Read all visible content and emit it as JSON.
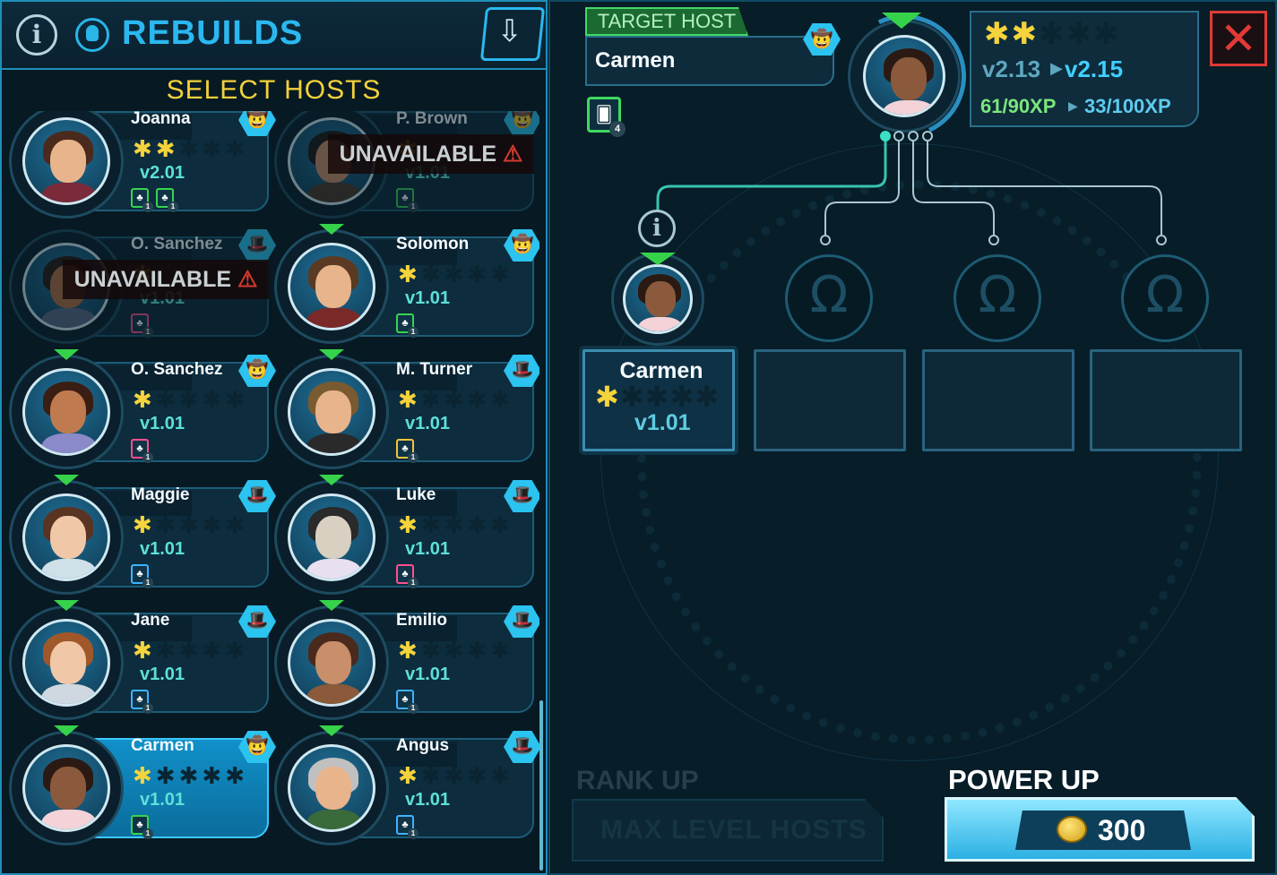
{
  "header": {
    "info_icon": "info-icon",
    "rebuild_icon": "rebuild-icon",
    "title": "REBUILDS",
    "sort_icon": "sort-icon"
  },
  "subtitle": "SELECT HOSTS",
  "unavailable_label": "UNAVAILABLE",
  "hosts": [
    {
      "name": "Joanna",
      "stars_on": 2,
      "stars_total": 5,
      "version": "v2.01",
      "hat": "white-hat",
      "badges": [
        "1",
        "1"
      ],
      "available": true,
      "selected": false
    },
    {
      "name": "P. Brown",
      "stars_on": 1,
      "stars_total": 5,
      "version": "v1.01",
      "hat": "white-hat",
      "badges": [
        "1"
      ],
      "available": false,
      "selected": false
    },
    {
      "name": "O. Sanchez",
      "stars_on": 1,
      "stars_total": 5,
      "version": "v1.01",
      "hat": "black-hat",
      "badges": [
        "1"
      ],
      "available": false,
      "selected": false
    },
    {
      "name": "Solomon",
      "stars_on": 1,
      "stars_total": 5,
      "version": "v1.01",
      "hat": "white-hat",
      "badges": [
        "1"
      ],
      "available": true,
      "selected": false
    },
    {
      "name": "O. Sanchez",
      "stars_on": 1,
      "stars_total": 5,
      "version": "v1.01",
      "hat": "white-hat",
      "badges": [
        "1"
      ],
      "available": true,
      "selected": false
    },
    {
      "name": "M. Turner",
      "stars_on": 1,
      "stars_total": 5,
      "version": "v1.01",
      "hat": "black-hat",
      "badges": [
        "1"
      ],
      "available": true,
      "selected": false
    },
    {
      "name": "Maggie",
      "stars_on": 1,
      "stars_total": 5,
      "version": "v1.01",
      "hat": "black-hat",
      "badges": [
        "1"
      ],
      "available": true,
      "selected": false
    },
    {
      "name": "Luke",
      "stars_on": 1,
      "stars_total": 5,
      "version": "v1.01",
      "hat": "black-hat",
      "badges": [
        "1"
      ],
      "available": true,
      "selected": false
    },
    {
      "name": "Jane",
      "stars_on": 1,
      "stars_total": 5,
      "version": "v1.01",
      "hat": "black-hat",
      "badges": [
        "1"
      ],
      "available": true,
      "selected": false
    },
    {
      "name": "Emilio",
      "stars_on": 1,
      "stars_total": 5,
      "version": "v1.01",
      "hat": "black-hat",
      "badges": [
        "1"
      ],
      "available": true,
      "selected": false
    },
    {
      "name": "Carmen",
      "stars_on": 1,
      "stars_total": 5,
      "version": "v1.01",
      "hat": "brown-hat",
      "badges": [
        "1"
      ],
      "available": true,
      "selected": true
    },
    {
      "name": "Angus",
      "stars_on": 1,
      "stars_total": 5,
      "version": "v1.01",
      "hat": "black-hat",
      "badges": [
        "1"
      ],
      "available": true,
      "selected": false
    }
  ],
  "target": {
    "label": "TARGET HOST",
    "name": "Carmen",
    "hat": "brown-hat",
    "card_count": "4",
    "stars_on": 2,
    "stars_total": 5,
    "version_from": "v2.13",
    "version_to": "v2.15",
    "xp_from": "61/90XP",
    "xp_to": "33/100XP"
  },
  "slots": [
    {
      "name": "Carmen",
      "stars_on": 1,
      "stars_total": 5,
      "version": "v1.01",
      "filled": true
    },
    {
      "filled": false
    },
    {
      "filled": false
    },
    {
      "filled": false
    }
  ],
  "rank_up": {
    "label": "RANK UP",
    "button": "MAX LEVEL HOSTS"
  },
  "power_up": {
    "label": "POWER UP",
    "price": "300",
    "currency_icon": "coin-icon"
  },
  "colors": {
    "accent": "#2bb8f0",
    "star": "#f4d33c",
    "available_tri": "#36d34a",
    "close": "#e03a36"
  }
}
